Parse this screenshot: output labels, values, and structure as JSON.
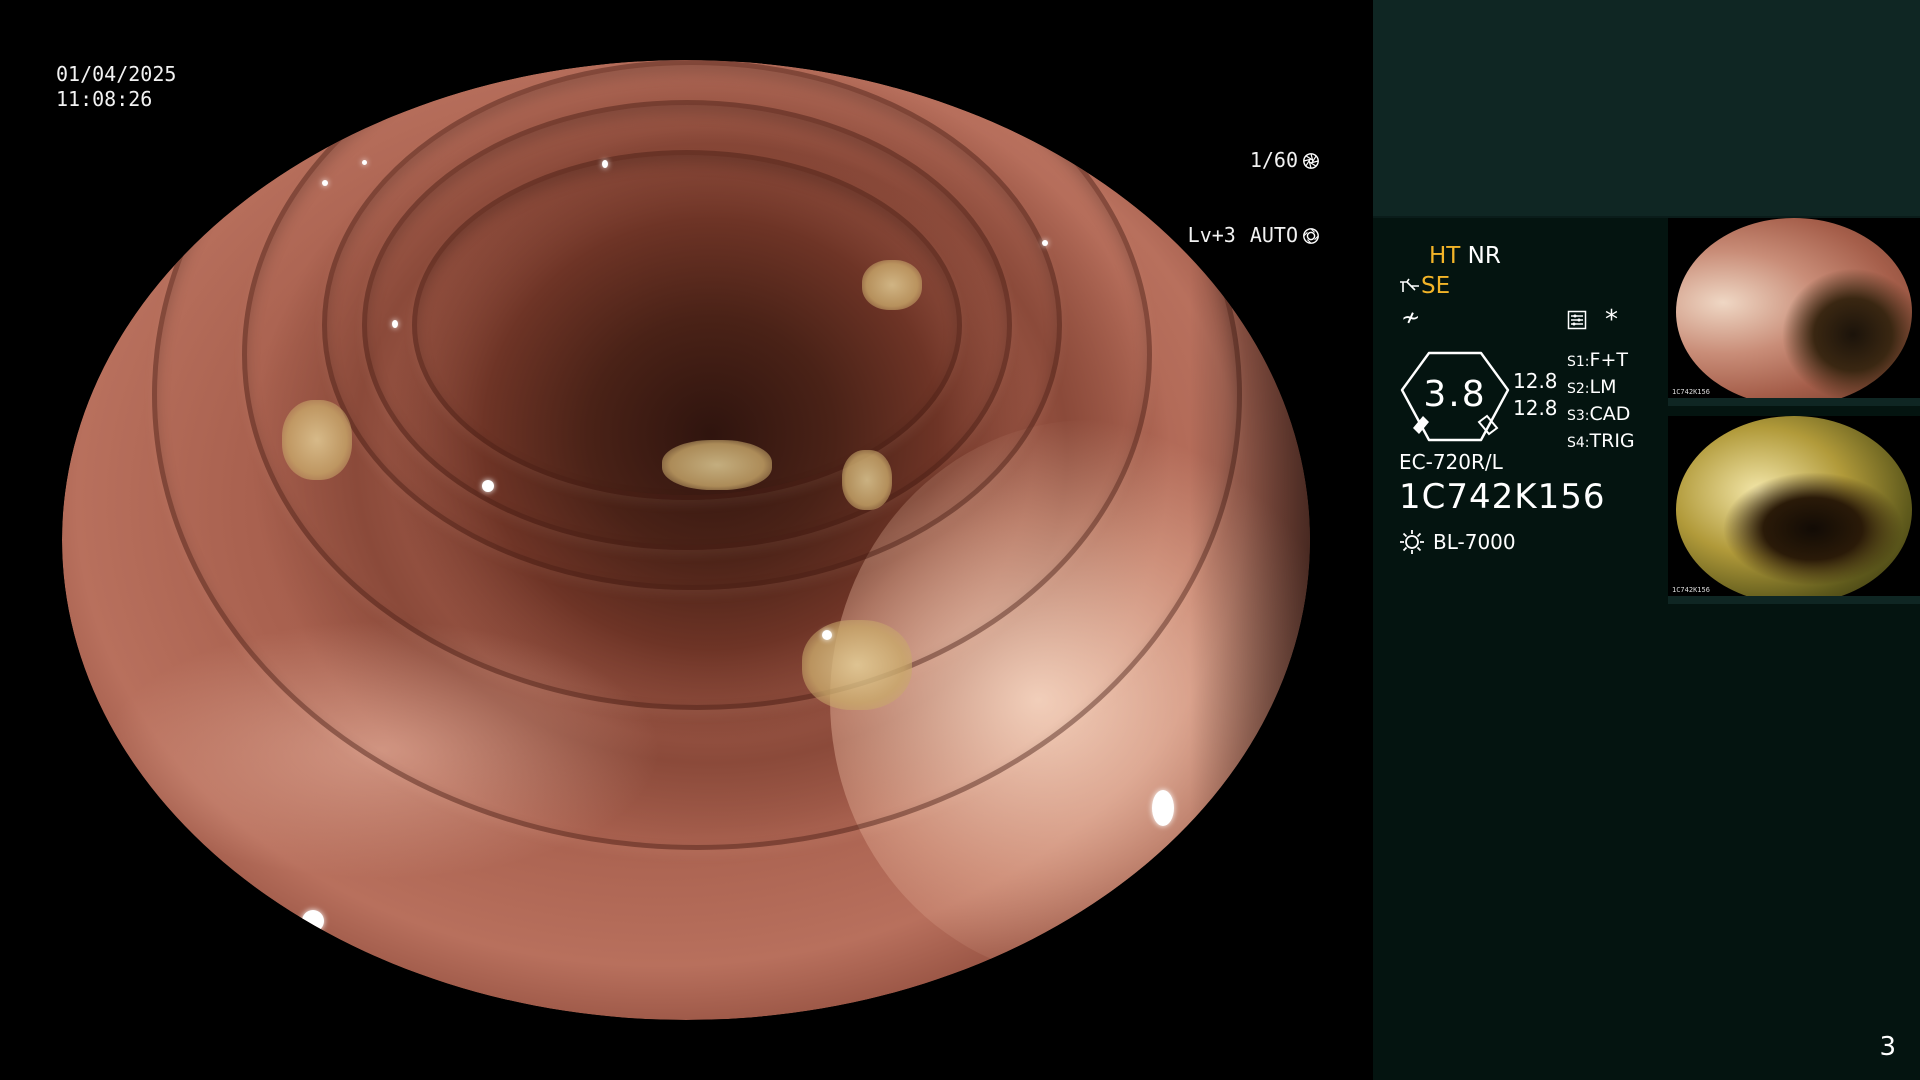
{
  "overlay": {
    "date": "01/04/2025",
    "time": "11:08:26",
    "shutter": "1/60",
    "level": "Lv+3",
    "mode": "AUTO",
    "shutter_icon": "shutter-icon",
    "auto_icon": "iris-icon"
  },
  "panel": {
    "ht": "HT",
    "nr": "NR",
    "se": "SE",
    "f_symbol": "≁",
    "gauge_value": "3.8",
    "values": [
      "12.8",
      "12.8"
    ],
    "slots": [
      {
        "key": "S1:",
        "value": "F+T"
      },
      {
        "key": "S2:",
        "value": "LM"
      },
      {
        "key": "S3:",
        "value": "CAD"
      },
      {
        "key": "S4:",
        "value": "TRIG"
      }
    ],
    "scope_model": "EC-720R/L",
    "serial": "1C742K156",
    "light_source": "BL-7000",
    "icons": [
      "menu-icon",
      "asterisk-icon",
      "light-source-icon",
      "se-icon"
    ],
    "accent": "#f3b428",
    "panel_bg": "#041410",
    "panel_top_bg": "#0f2623"
  },
  "thumbnails": [
    {
      "caption": "1C742K156"
    },
    {
      "caption": "1C742K156"
    }
  ],
  "page_number": "3"
}
